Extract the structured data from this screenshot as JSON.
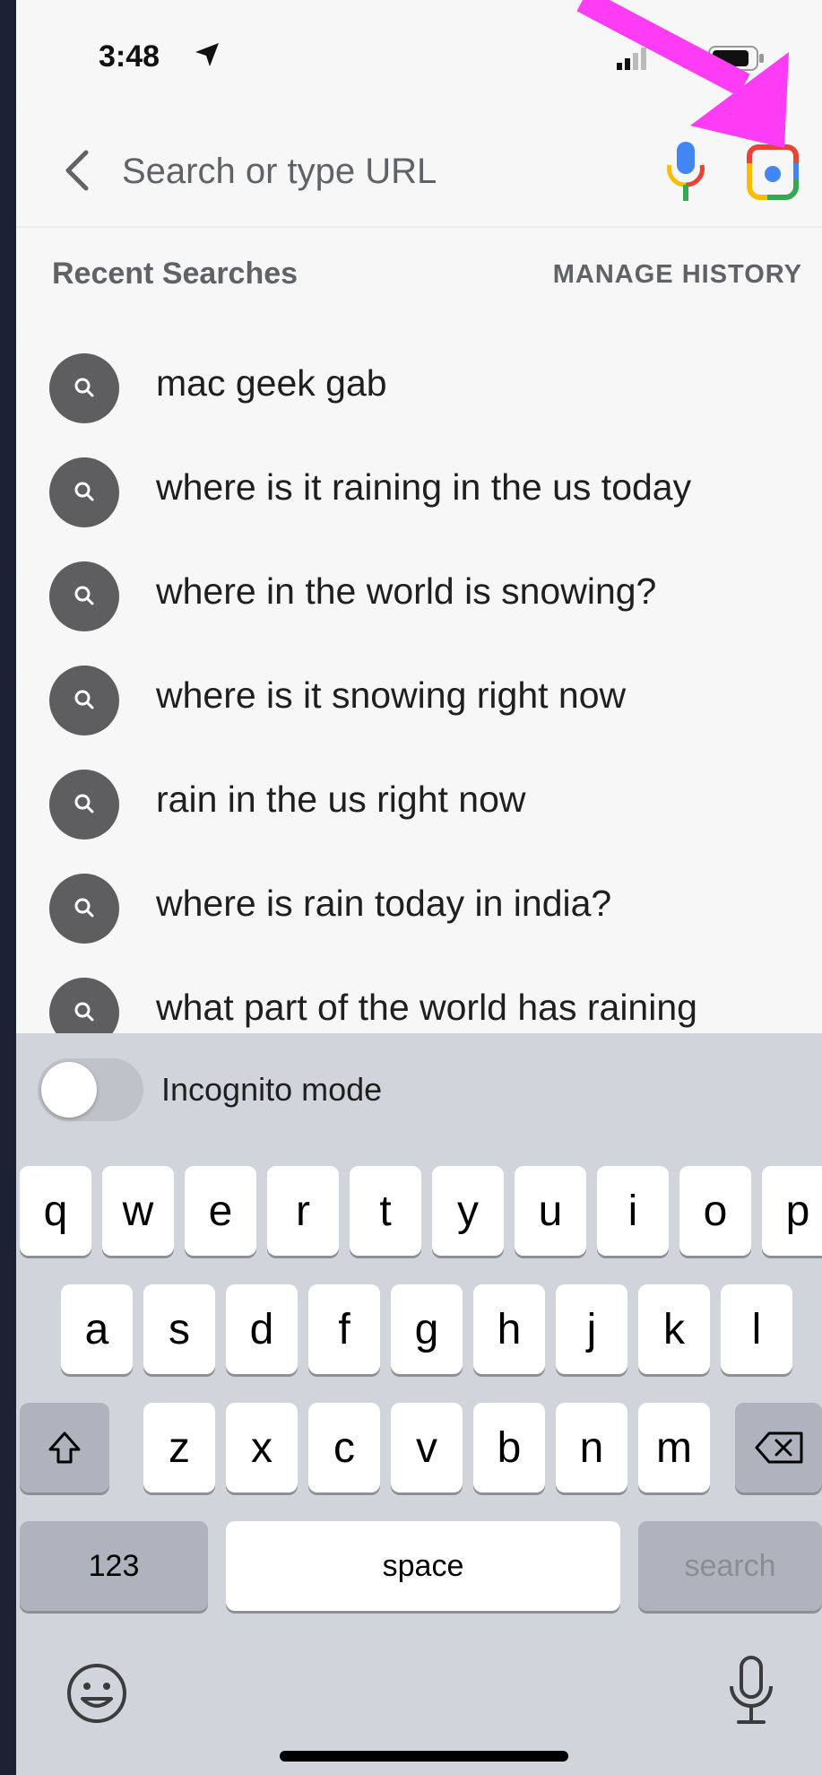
{
  "status_bar": {
    "time": "3:48"
  },
  "search_bar": {
    "placeholder": "Search or type URL"
  },
  "recent": {
    "title": "Recent Searches",
    "manage_label": "MANAGE HISTORY",
    "items": [
      {
        "label": "mac geek gab"
      },
      {
        "label": "where is it raining in the us today"
      },
      {
        "label": "where in the world is snowing?"
      },
      {
        "label": "where is it snowing right now"
      },
      {
        "label": "rain in the us right now"
      },
      {
        "label": "where is rain today in india?"
      },
      {
        "label": "what part of the world has raining"
      }
    ]
  },
  "keyboard": {
    "incognito_label": "Incognito mode",
    "incognito_on": false,
    "row1": [
      "q",
      "w",
      "e",
      "r",
      "t",
      "y",
      "u",
      "i",
      "o",
      "p"
    ],
    "row2": [
      "a",
      "s",
      "d",
      "f",
      "g",
      "h",
      "j",
      "k",
      "l"
    ],
    "row3": [
      "z",
      "x",
      "c",
      "v",
      "b",
      "n",
      "m"
    ],
    "numbers_label": "123",
    "space_label": "space",
    "search_label": "search"
  },
  "colors": {
    "annotation_arrow": "#ff3cf5",
    "mic_blue": "#4285f4",
    "mic_red": "#ea4335",
    "mic_green": "#34a853",
    "mic_yellow": "#fbbc04",
    "search_icon_bg": "#5e5e60",
    "keyboard_bg": "#d1d4db"
  },
  "icons": {
    "back": "chevron-left-icon",
    "mic": "google-mic-icon",
    "lens": "google-lens-icon",
    "search": "search-icon",
    "shift": "shift-icon",
    "backspace": "backspace-icon",
    "emoji": "emoji-icon",
    "dictation": "microphone-icon"
  }
}
